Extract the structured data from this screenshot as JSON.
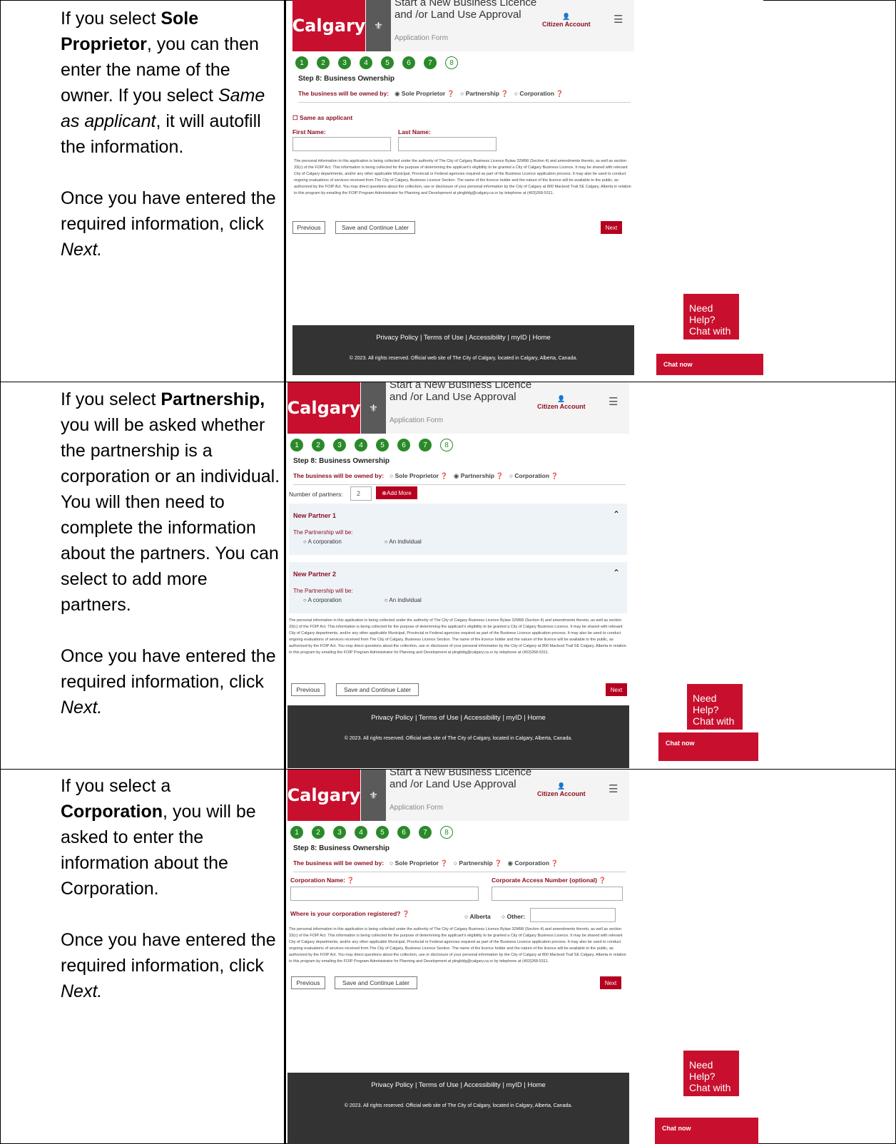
{
  "rows": [
    {
      "p1": [
        "If you select ",
        {
          "b": "Sole Proprietor"
        },
        ", you can then enter the name of the owner. If you select ",
        {
          "i": "Same as applicant"
        },
        ", it will autofill the information."
      ],
      "p2": [
        "Once you have entered the required information, click ",
        {
          "i": "Next."
        }
      ]
    },
    {
      "p1": [
        "If you select ",
        {
          "b": "Partnership,"
        },
        " you will be asked whether the partnership is a corporation or an individual. You will then need to complete the information about the partners. You can select to add more partners."
      ],
      "p2": [
        "Once you have entered the required information, click ",
        {
          "i": "Next."
        }
      ]
    },
    {
      "p1": [
        "If you select a ",
        {
          "b": "Corporation"
        },
        ", you will be asked to enter the information about the Corporation."
      ],
      "p2": [
        "Once you have entered the required information, click ",
        {
          "i": "Next."
        }
      ]
    }
  ],
  "app": {
    "logo": "Calgary",
    "title": "Start a New Business Licence and /or Land Use Approval",
    "subtitle": "Application Form",
    "account": "Citizen Account",
    "steps": [
      "1",
      "2",
      "3",
      "4",
      "5",
      "6",
      "7",
      "8"
    ],
    "step_title": "Step 8: Business Ownership",
    "owned_by": "The business will be owned by:",
    "opt_sole": "Sole Proprietor",
    "opt_partner": "Partnership",
    "opt_corp": "Corporation",
    "same_as": "Same as applicant",
    "first": "First Name:",
    "last": "Last Name:",
    "num_partners": "Number of partners:",
    "num_val": "2",
    "add_more": "Add More",
    "partner1": "New Partner 1",
    "partner2": "New Partner 2",
    "p_will": "The Partnership will be:",
    "a_corp": "A corporation",
    "an_ind": "An individual",
    "corp_name": "Corporation Name:",
    "corp_access": "Corporate Access Number (optional)",
    "corp_reg": "Where is your corporation registered?",
    "alberta": "Alberta",
    "other": "Other:",
    "legal": "The personal information in this application is being collected under the authority of The City of Calgary Business Licence Bylaw 32M98 (Section 4) and amendments thereto, as well as section 33(c) of the FOIP Act. This information is being collected for the purpose of determining the applicant's eligibility to be granted a City of Calgary Business Licence. It may be shared with relevant City of Calgary departments, and/or any other applicable Municipal, Provincial or Federal agencies required as part of the Business Licence application process. It may also be used to conduct ongoing evaluations of services received from The City of Calgary, Business Licence Section. The name of the licence holder and the nature of the licence will be available to the public, as authorized by the FOIP Act. You may direct questions about the collection, use or disclosure of your personal information by the City of Calgary at 800 Macleod Trail SE Calgary, Alberta in relation to this program by emailing the FOIP Program Administrator for Planning and Development at plngbldg@calgary.ca or by telephone at (403)268-5311.",
    "previous": "Previous",
    "save": "Save and Continue Later",
    "next": "Next",
    "footer_links": "Privacy Policy | Terms of Use | Accessibility | myID | Home",
    "footer_copy": "© 2023. All rights reserved. Official web site of The City of Calgary, located in Calgary, Alberta, Canada.",
    "help": "Need Help? Chat with us!",
    "chat": "Chat now"
  }
}
